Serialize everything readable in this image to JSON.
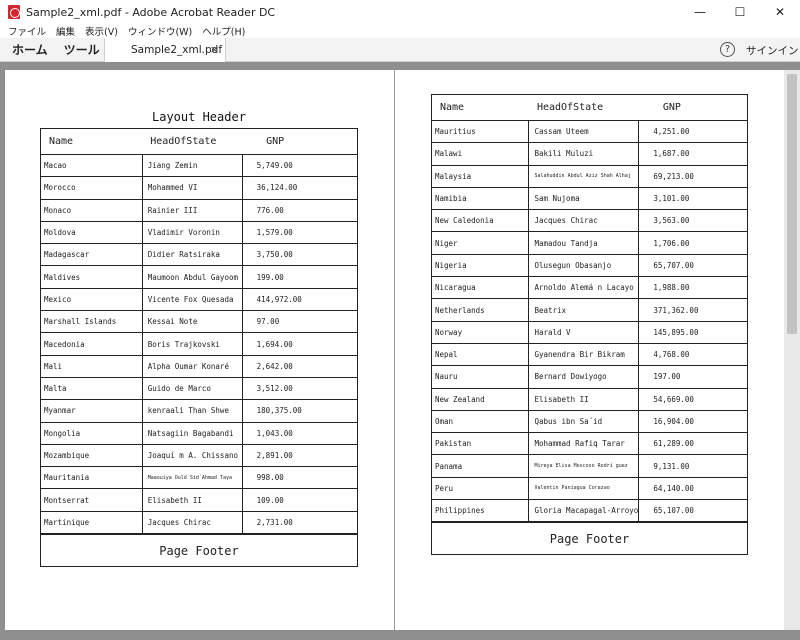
{
  "window": {
    "title": "Sample2_xml.pdf - Adobe Acrobat Reader DC",
    "minimize_glyph": "—",
    "maximize_glyph": "☐",
    "close_glyph": "✕"
  },
  "menu": [
    "ファイル",
    "編集",
    "表示(V)",
    "ウィンドウ(W)",
    "ヘルプ(H)"
  ],
  "toolbar": {
    "home_label": "ホーム",
    "tools_label": "ツール",
    "doc_tab_label": "Sample2_xml.pdf",
    "doc_tab_close": "×",
    "help_glyph": "?",
    "signin_label": "サインイン"
  },
  "report": {
    "layout_header": "Layout Header",
    "page_footer": "Page Footer",
    "columns": [
      "Name",
      "HeadOfState",
      "GNP"
    ]
  },
  "page1_rows": [
    [
      "Macao",
      "Jiang Zemin",
      "5,749.00"
    ],
    [
      "Morocco",
      "Mohammed VI",
      "36,124.00"
    ],
    [
      "Monaco",
      "Rainier III",
      "776.00"
    ],
    [
      "Moldova",
      "Vladimir Voronin",
      "1,579.00"
    ],
    [
      "Madagascar",
      "Didier Ratsiraka",
      "3,750.00"
    ],
    [
      "Maldives",
      "Maumoon Abdul Gayoom",
      "199.00"
    ],
    [
      "Mexico",
      "Vicente Fox Quesada",
      "414,972.00"
    ],
    [
      "Marshall Islands",
      "Kessai Note",
      "97.00"
    ],
    [
      "Macedonia",
      "Boris Trajkovski",
      "1,694.00"
    ],
    [
      "Mali",
      "Alpha Oumar Konaré",
      "2,642.00"
    ],
    [
      "Malta",
      "Guido de Marco",
      "3,512.00"
    ],
    [
      "Myanmar",
      "kenraali Than Shwe",
      "180,375.00"
    ],
    [
      "Mongolia",
      "Natsagiin Bagabandi",
      "1,043.00"
    ],
    [
      "Mozambique",
      "Joaquí m A. Chissano",
      "2,891.00"
    ],
    [
      "Mauritania",
      "Maaouiya Ould Sid´Ahmad Taya",
      "998.00"
    ],
    [
      "Montserrat",
      "Elisabeth II",
      "109.00"
    ],
    [
      "Martinique",
      "Jacques Chirac",
      "2,731.00"
    ]
  ],
  "page2_rows": [
    [
      "Mauritius",
      "Cassam Uteem",
      "4,251.00"
    ],
    [
      "Malawi",
      "Bakili Muluzi",
      "1,687.00"
    ],
    [
      "Malaysia",
      "Salahuddin Abdul Aziz Shah Alhaj",
      "69,213.00"
    ],
    [
      "Namibia",
      "Sam Nujoma",
      "3,101.00"
    ],
    [
      "New Caledonia",
      "Jacques Chirac",
      "3,563.00"
    ],
    [
      "Niger",
      "Mamadou Tandja",
      "1,706.00"
    ],
    [
      "Nigeria",
      "Olusegun Obasanjo",
      "65,707.00"
    ],
    [
      "Nicaragua",
      "Arnoldo Alemá n Lacayo",
      "1,988.00"
    ],
    [
      "Netherlands",
      "Beatrix",
      "371,362.00"
    ],
    [
      "Norway",
      "Harald V",
      "145,895.00"
    ],
    [
      "Nepal",
      "Gyanendra Bir Bikram",
      "4,768.00"
    ],
    [
      "Nauru",
      "Bernard Dowiyogo",
      "197.00"
    ],
    [
      "New Zealand",
      "Elisabeth II",
      "54,669.00"
    ],
    [
      "Oman",
      "Qabus ibn Sa´id",
      "16,904.00"
    ],
    [
      "Pakistan",
      "Mohammad Rafiq Tarar",
      "61,289.00"
    ],
    [
      "Panama",
      "Mireya Elisa Moscoso Rodrí guez",
      "9,131.00"
    ],
    [
      "Peru",
      "Valentin Paniagua Corazao",
      "64,140.00"
    ],
    [
      "Philippines",
      "Gloria Macapagal-Arroyo",
      "65,107.00"
    ]
  ]
}
